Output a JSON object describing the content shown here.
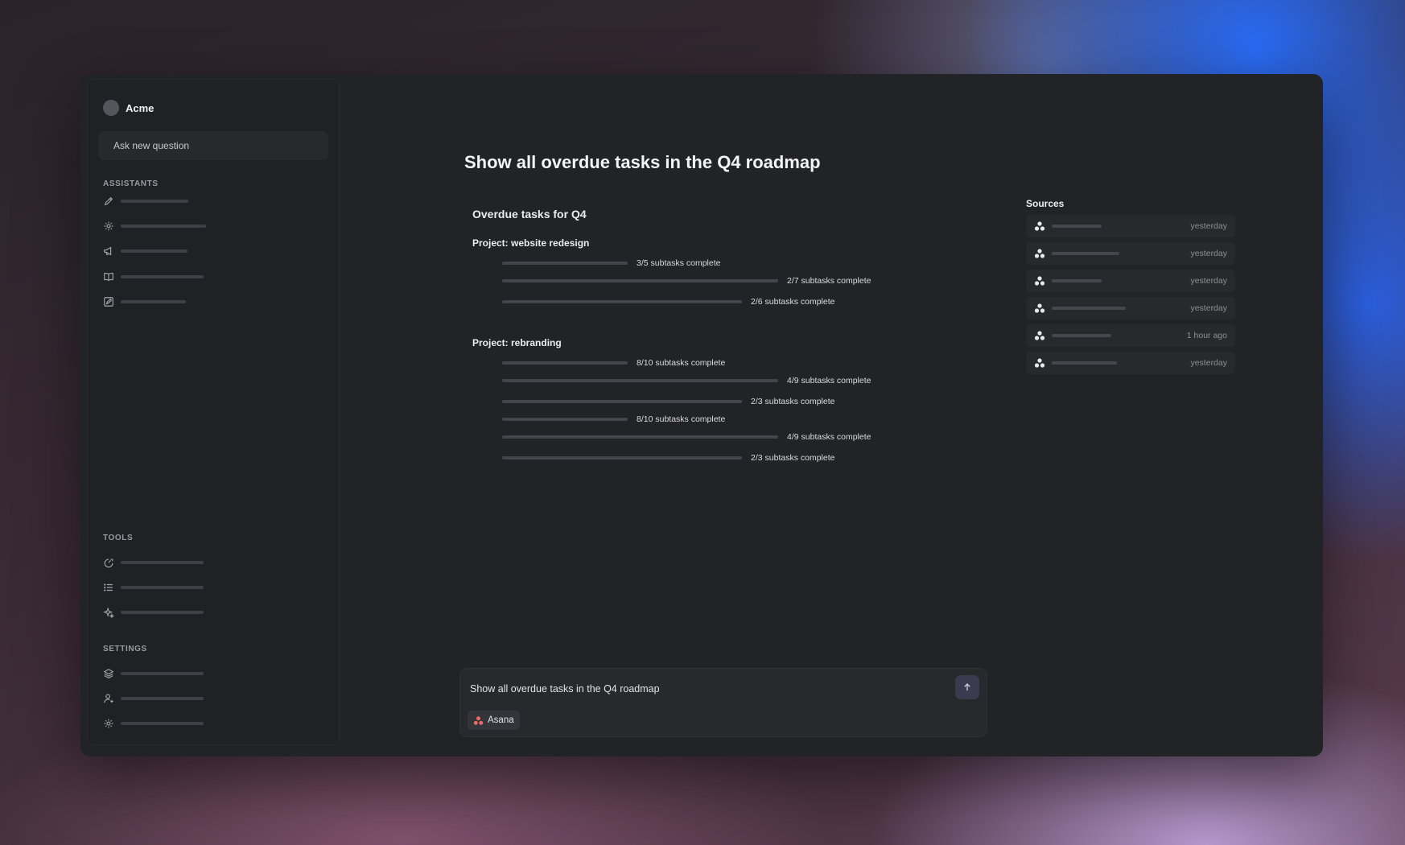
{
  "brand": {
    "name": "Acme"
  },
  "sidebar": {
    "ask_label": "Ask new question",
    "sections": {
      "assistants": "ASSISTANTS",
      "tools": "TOOLS",
      "settings": "SETTINGS"
    },
    "assistant_icons": [
      "pen-icon",
      "gear-icon",
      "megaphone-icon",
      "book-icon",
      "edit-icon"
    ],
    "tool_icons": [
      "gauge-icon",
      "list-icon",
      "sparkle-icon"
    ],
    "setting_icons": [
      "layers-icon",
      "user-plus-icon",
      "gear-icon"
    ]
  },
  "main": {
    "title": "Show all overdue tasks in the Q4 roadmap",
    "answer": {
      "heading": "Overdue tasks for Q4",
      "projects": [
        {
          "name": "Project: website redesign",
          "tasks": [
            {
              "label": "3/5 subtasks complete"
            },
            {
              "label": "2/7 subtasks complete"
            },
            {
              "label": "2/6 subtasks complete"
            }
          ]
        },
        {
          "name": "Project: rebranding",
          "tasks": [
            {
              "label": "8/10 subtasks complete"
            },
            {
              "label": "4/9 subtasks complete"
            },
            {
              "label": "2/3 subtasks complete"
            },
            {
              "label": "8/10 subtasks complete"
            },
            {
              "label": "4/9 subtasks complete"
            },
            {
              "label": "2/3 subtasks complete"
            }
          ]
        }
      ]
    },
    "sources": {
      "title": "Sources",
      "items": [
        {
          "icon": "asana-icon",
          "time": "yesterday"
        },
        {
          "icon": "asana-icon",
          "time": "yesterday"
        },
        {
          "icon": "asana-icon",
          "time": "yesterday"
        },
        {
          "icon": "asana-icon",
          "time": "yesterday"
        },
        {
          "icon": "asana-icon",
          "time": "1 hour ago"
        },
        {
          "icon": "asana-icon",
          "time": "yesterday"
        }
      ]
    }
  },
  "composer": {
    "query": "Show all overdue tasks in the Q4 roadmap",
    "chip_label": "Asana",
    "send_icon": "arrow-up-icon"
  },
  "colors": {
    "window": "#222326",
    "accent_send": "#3c3a4e",
    "asana": "#f06a6a"
  }
}
